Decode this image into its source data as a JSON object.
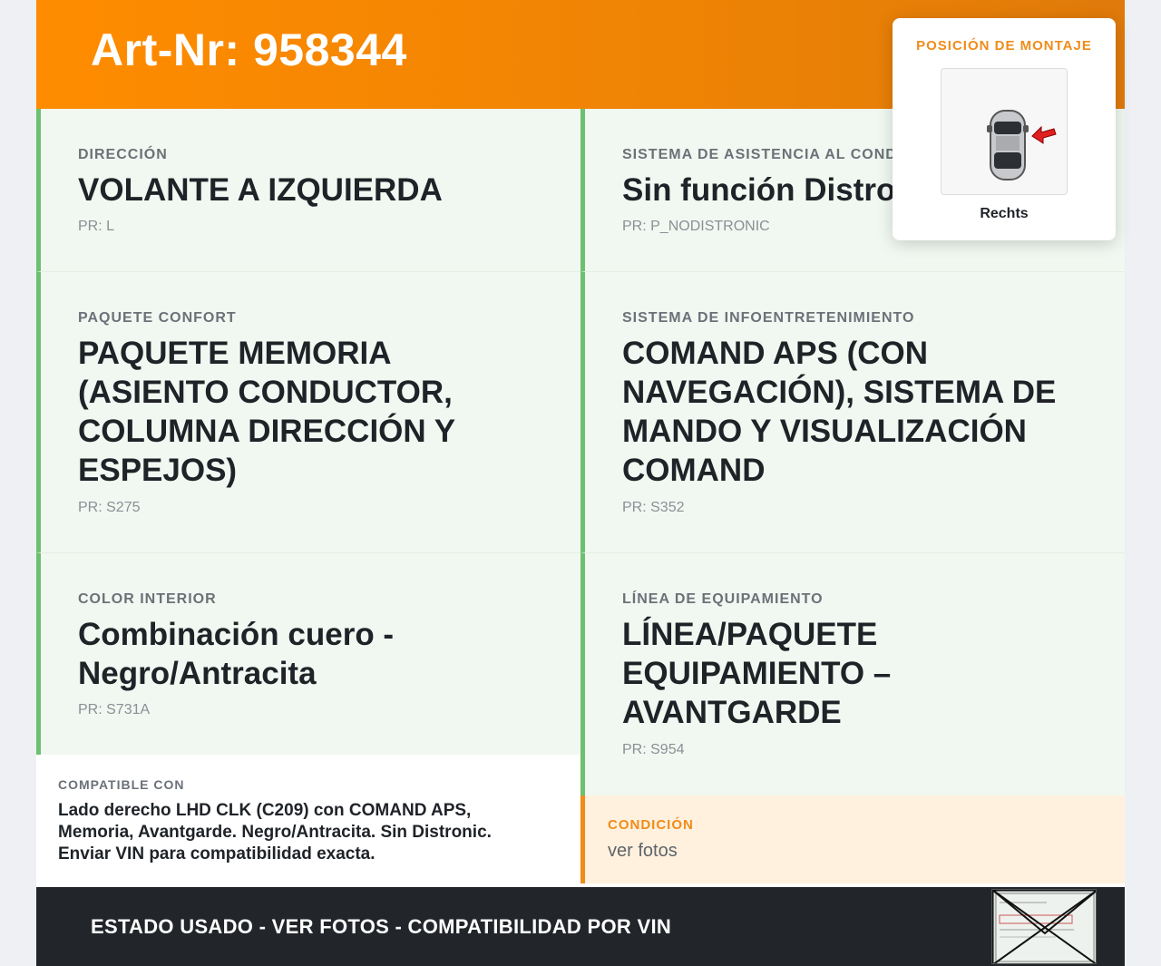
{
  "header": {
    "article_number": "Art-Nr: 958344"
  },
  "mounting": {
    "label": "POSICIÓN DE MONTAJE",
    "side": "Rechts"
  },
  "features": [
    {
      "label": "DIRECCIÓN",
      "value": "VOLANTE A IZQUIERDA",
      "pr": "PR: L"
    },
    {
      "label": "SISTEMA DE ASISTENCIA AL CONDUCTOR",
      "value": "Sin función Distronic",
      "pr": "PR: P_NODISTRONIC"
    },
    {
      "label": "PAQUETE CONFORT",
      "value": "PAQUETE MEMORIA (ASIENTO CONDUCTOR, COLUMNA DIRECCIÓN Y ESPEJOS)",
      "pr": "PR: S275"
    },
    {
      "label": "SISTEMA DE INFOENTRETENIMIENTO",
      "value": "COMAND APS (CON NAVEGACIÓN), SISTEMA DE MANDO Y VISUALIZACIÓN COMAND",
      "pr": "PR: S352"
    },
    {
      "label": "COLOR INTERIOR",
      "value": "Combinación cuero - Negro/Antracita",
      "pr": "PR: S731A"
    },
    {
      "label": "LÍNEA DE EQUIPAMIENTO",
      "value": "LÍNEA/PAQUETE EQUIPAMIENTO – AVANTGARDE",
      "pr": "PR: S954"
    }
  ],
  "compatibility": {
    "label": "COMPATIBLE CON",
    "text": "Lado derecho LHD CLK (C209) con COMAND APS, Memoria, Avantgarde. Negro/Antracita. Sin Distronic. Enviar VIN para compatibilidad exacta."
  },
  "condition": {
    "label": "CONDICIÓN",
    "value": "ver fotos"
  },
  "footer": {
    "text": "ESTADO USADO - VER FOTOS - COMPATIBILIDAD POR VIN"
  },
  "colors": {
    "brand_orange": "#ff8c00",
    "green_accent": "#6cc070",
    "footer_bg": "#22252a"
  },
  "icons": {
    "mounting_image": "car-top-view-icon",
    "arrow": "red-arrow-icon",
    "thumbnail": "vin-plate-thumbnail"
  }
}
